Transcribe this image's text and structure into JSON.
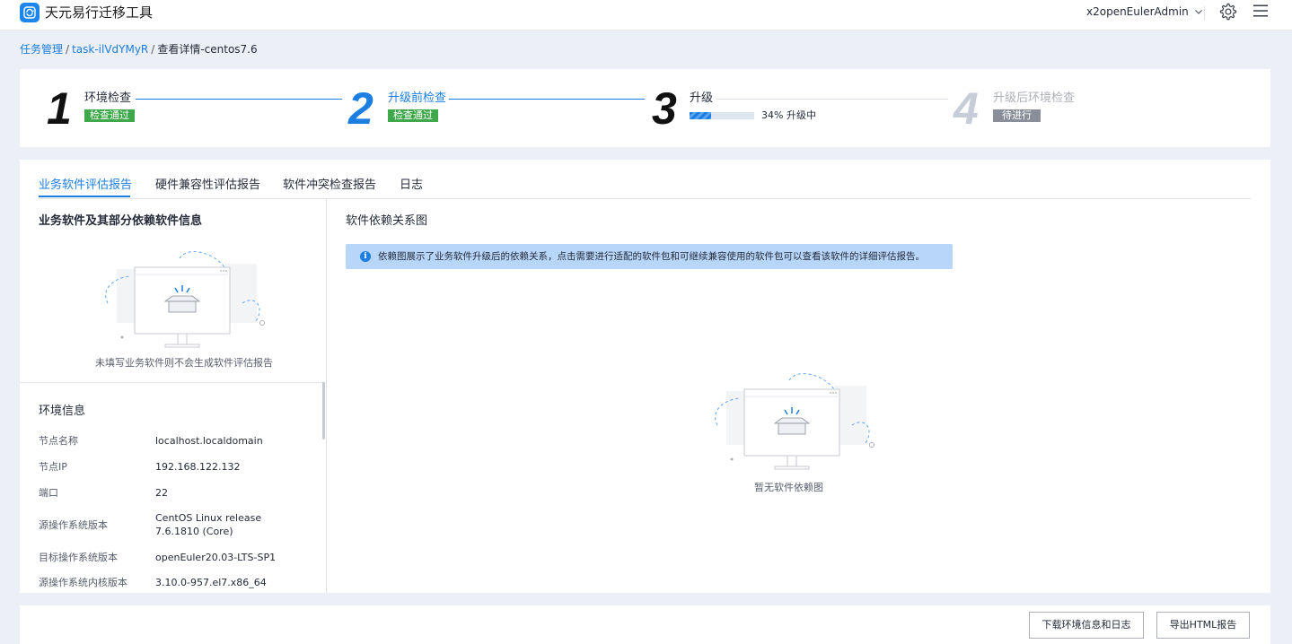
{
  "header": {
    "app_title": "天元易行迁移工具",
    "username": "x2openEulerAdmin",
    "logo_icon": "refresh-icon",
    "settings_icon": "gear-icon",
    "menu_icon": "hamburger-icon"
  },
  "breadcrumb": {
    "items": [
      "任务管理",
      "task-ilVdYMyR",
      "查看详情-centos7.6"
    ],
    "separator": "/"
  },
  "steps": [
    {
      "number": "1",
      "title": "环境检查",
      "status": "检查通过"
    },
    {
      "number": "2",
      "title": "升级前检查",
      "status": "检查通过"
    },
    {
      "number": "3",
      "title": "升级",
      "progress_percent": 34,
      "progress_text": "34% 升级中"
    },
    {
      "number": "4",
      "title": "升级后环境检查",
      "status": "待进行"
    }
  ],
  "tabs": [
    {
      "label": "业务软件评估报告",
      "active": true
    },
    {
      "label": "硬件兼容性评估报告",
      "active": false
    },
    {
      "label": "软件冲突检查报告",
      "active": false
    },
    {
      "label": "日志",
      "active": false
    }
  ],
  "left_panel": {
    "title": "业务软件及其部分依赖软件信息",
    "empty_text": "未填写业务软件则不会生成软件评估报告",
    "env_title": "环境信息",
    "env_rows": [
      {
        "label": "节点名称",
        "value": "localhost.localdomain"
      },
      {
        "label": "节点IP",
        "value": "192.168.122.132"
      },
      {
        "label": "端口",
        "value": "22"
      },
      {
        "label": "源操作系统版本",
        "value": "CentOS Linux release 7.6.1810 (Core)"
      },
      {
        "label": "目标操作系统版本",
        "value": "openEuler20.03-LTS-SP1"
      },
      {
        "label": "源操作系统内核版本",
        "value": "3.10.0-957.el7.x86_64"
      }
    ]
  },
  "right_panel": {
    "title": "软件依赖关系图",
    "info_icon": "info-icon",
    "info_text": "依赖图展示了业务软件升级后的依赖关系，点击需要进行适配的软件包和可继续兼容使用的软件包可以查看该软件的详细评估报告。",
    "empty_text": "暂无软件依赖图"
  },
  "footer": {
    "download_button": "下载环境信息和日志",
    "export_button": "导出HTML报告"
  },
  "colors": {
    "accent": "#1c7ee0",
    "success": "#3fa84a",
    "pending": "#8a8e99",
    "inactive_step": "#c7cdd8",
    "info_bg": "#b8d6fa",
    "page_bg": "#eceff5"
  }
}
